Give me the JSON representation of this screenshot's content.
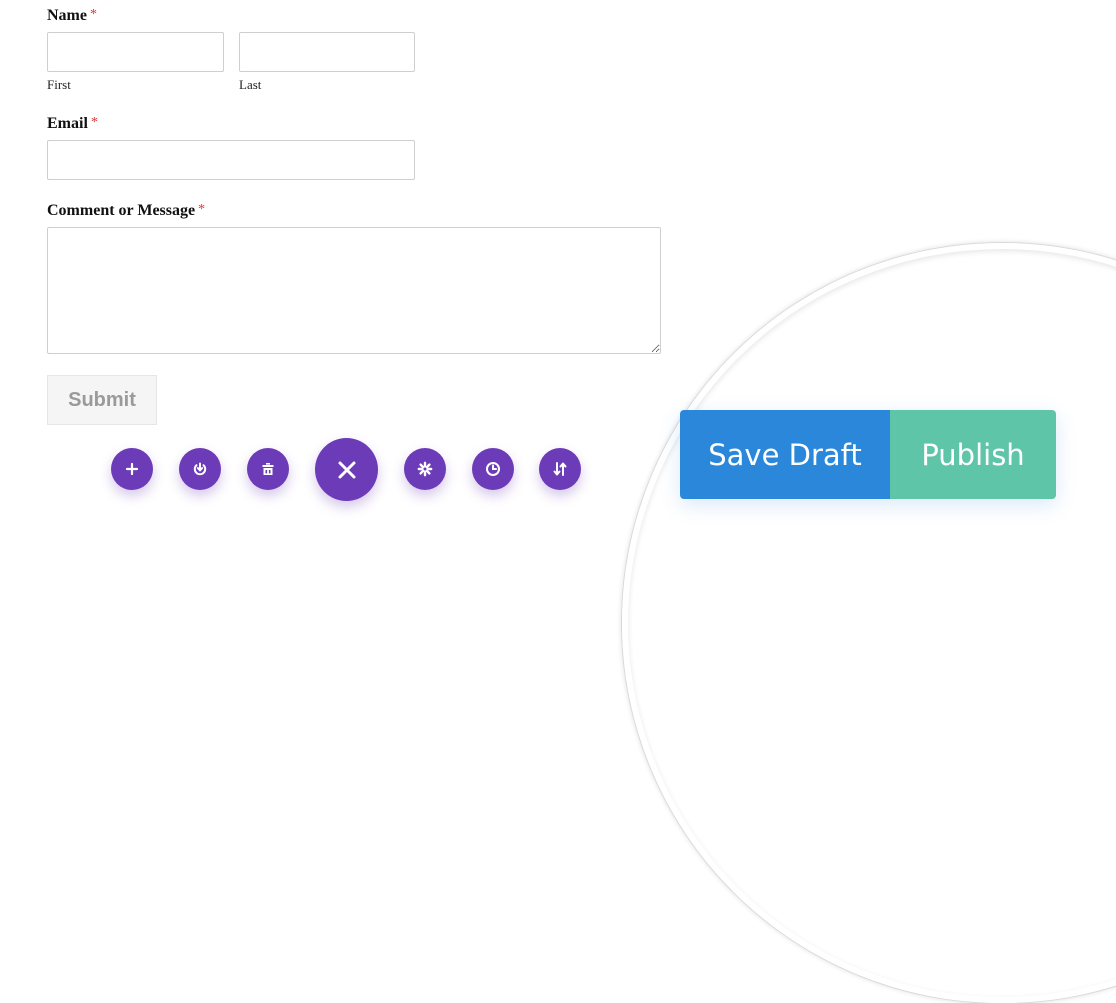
{
  "form": {
    "name": {
      "label": "Name",
      "required_mark": "*",
      "first": {
        "value": "",
        "sublabel": "First"
      },
      "last": {
        "value": "",
        "sublabel": "Last"
      }
    },
    "email": {
      "label": "Email",
      "required_mark": "*",
      "value": ""
    },
    "message": {
      "label": "Comment or Message",
      "required_mark": "*",
      "value": ""
    },
    "submit_label": "Submit"
  },
  "toolbar": {
    "buttons": [
      {
        "name": "add",
        "icon": "plus-icon"
      },
      {
        "name": "portability",
        "icon": "power-download-icon"
      },
      {
        "name": "clear-layout",
        "icon": "trash-icon"
      },
      {
        "name": "close",
        "icon": "close-icon"
      },
      {
        "name": "page-settings",
        "icon": "gear-icon"
      },
      {
        "name": "history",
        "icon": "clock-icon"
      },
      {
        "name": "sort",
        "icon": "sort-arrows-icon"
      }
    ],
    "accent_color": "#6c3bb8"
  },
  "actions": {
    "save_draft_label": "Save Draft",
    "publish_label": "Publish",
    "save_draft_color": "#2b87da",
    "publish_color": "#5fc5a9"
  }
}
